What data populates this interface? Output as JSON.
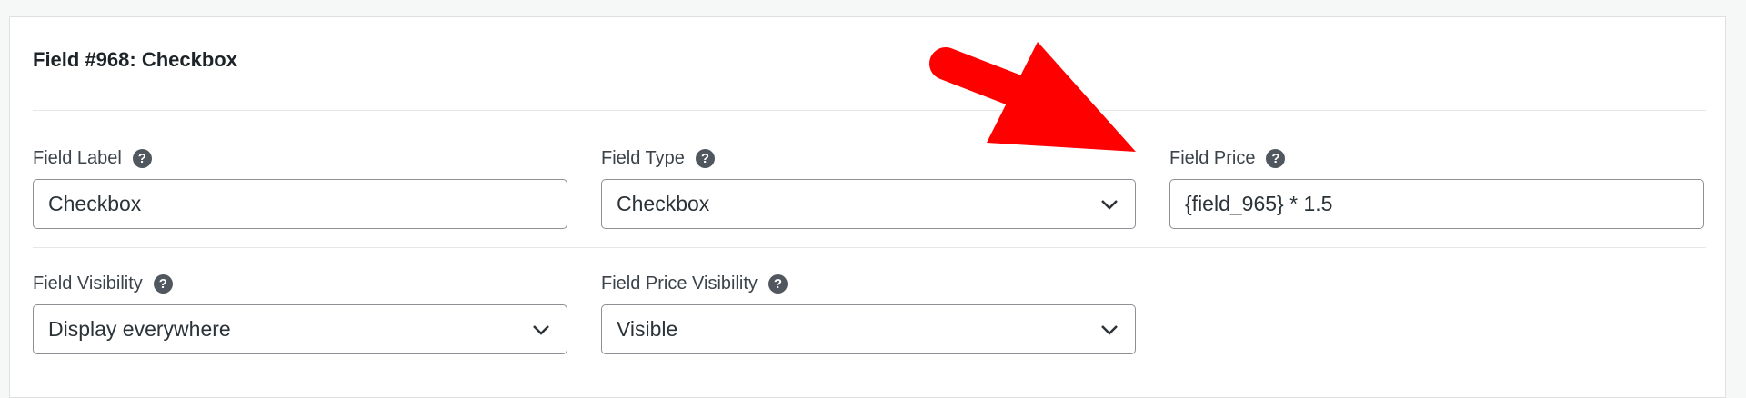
{
  "section": {
    "title": "Field #968: Checkbox"
  },
  "fields": {
    "field_label": {
      "label": "Field Label",
      "value": "Checkbox"
    },
    "field_type": {
      "label": "Field Type",
      "value": "Checkbox"
    },
    "field_price": {
      "label": "Field Price",
      "value": "{field_965} * 1.5"
    },
    "field_visibility": {
      "label": "Field Visibility",
      "value": "Display everywhere"
    },
    "field_price_visibility": {
      "label": "Field Price Visibility",
      "value": "Visible"
    }
  },
  "help_glyph": "?",
  "annotation": {
    "icon": "arrow-icon",
    "color": "#ff0000"
  }
}
